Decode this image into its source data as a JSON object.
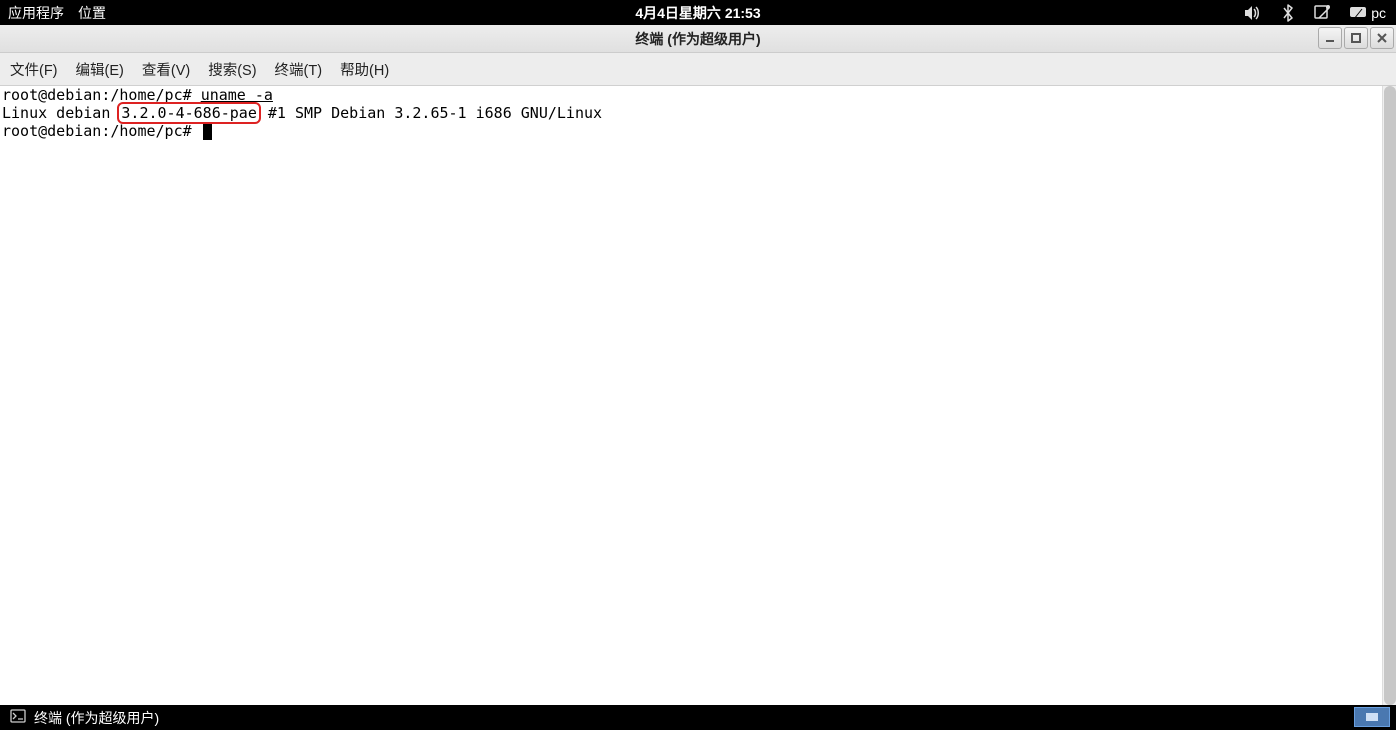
{
  "top_panel": {
    "apps_label": "应用程序",
    "places_label": "位置",
    "clock": "4月4日星期六 21:53",
    "user_label": "pc"
  },
  "window": {
    "title": "终端 (作为超级用户)"
  },
  "menubar": {
    "file": "文件(F)",
    "edit": "编辑(E)",
    "view": "查看(V)",
    "search": "搜索(S)",
    "terminal": "终端(T)",
    "help": "帮助(H)"
  },
  "terminal": {
    "prompt1_prefix": "root@debian:/home/pc# ",
    "prompt1_cmd": "uname -a",
    "line2_prefix": "Linux debian ",
    "line2_highlight": "3.2.0-4-686-pae",
    "line2_suffix": " #1 SMP Debian 3.2.65-1 i686 GNU/Linux",
    "prompt2": "root@debian:/home/pc# "
  },
  "taskbar": {
    "task1": "终端 (作为超级用户)"
  }
}
